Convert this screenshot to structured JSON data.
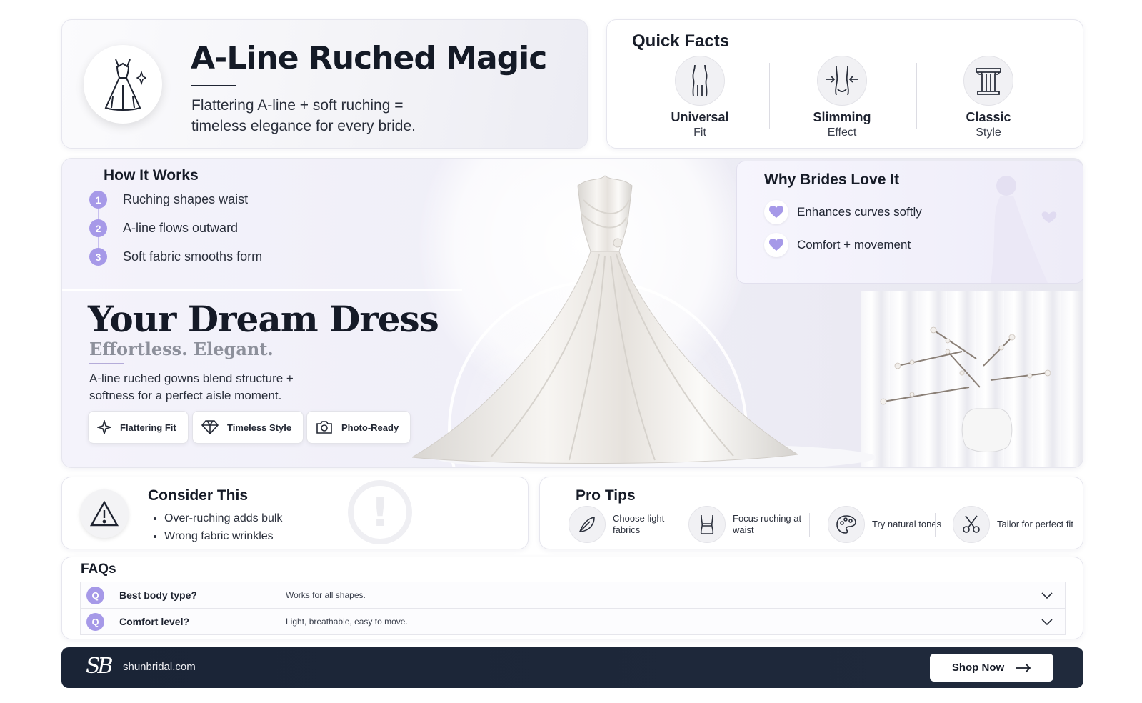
{
  "hero": {
    "title": "A-Line Ruched Magic",
    "subtitle": "Flattering A-line + soft ruching = timeless elegance for every bride.",
    "icon": "dress-sparkle-icon"
  },
  "quick_facts": {
    "heading": "Quick Facts",
    "items": [
      {
        "title": "Universal",
        "subtitle": "Fit",
        "icon": "body-silhouette-icon"
      },
      {
        "title": "Slimming",
        "subtitle": "Effect",
        "icon": "waist-arrows-icon"
      },
      {
        "title": "Classic",
        "subtitle": "Style",
        "icon": "column-icon"
      }
    ]
  },
  "how_it_works": {
    "heading": "How It Works",
    "steps": [
      {
        "num": "1",
        "label": "Ruching shapes waist"
      },
      {
        "num": "2",
        "label": "A-line flows outward"
      },
      {
        "num": "3",
        "label": "Soft fabric smooths form"
      }
    ]
  },
  "why_brides": {
    "heading": "Why Brides Love It",
    "items": [
      {
        "label": "Enhances curves softly",
        "icon": "heart-icon"
      },
      {
        "label": "Comfort + movement",
        "icon": "heart-icon"
      }
    ]
  },
  "dream": {
    "title": "Your Dream Dress",
    "subtitle": "Effortless. Elegant.",
    "description": "A-line ruched gowns blend structure + softness for a perfect aisle moment.",
    "pills": [
      {
        "label": "Flattering Fit",
        "icon": "sparkle-icon"
      },
      {
        "label": "Timeless Style",
        "icon": "diamond-icon"
      },
      {
        "label": "Photo-Ready",
        "icon": "camera-icon"
      }
    ]
  },
  "consider": {
    "heading": "Consider This",
    "items": [
      "Over-ruching adds bulk",
      "Wrong fabric wrinkles"
    ],
    "icon": "warning-icon"
  },
  "pro_tips": {
    "heading": "Pro Tips",
    "items": [
      {
        "label": "Choose light fabrics",
        "icon": "feather-icon"
      },
      {
        "label": "Focus ruching at waist",
        "icon": "bodice-icon"
      },
      {
        "label": "Try natural tones",
        "icon": "palette-icon"
      },
      {
        "label": "Tailor for perfect fit",
        "icon": "scissors-icon"
      }
    ]
  },
  "faqs": {
    "heading": "FAQs",
    "items": [
      {
        "badge": "Q",
        "question": "Best body type?",
        "answer": "Works for all shapes."
      },
      {
        "badge": "Q",
        "question": "Comfort level?",
        "answer": "Light, breathable, easy to move."
      }
    ]
  },
  "footer": {
    "logo": "SB",
    "site": "shunbridal.com",
    "cta": "Shop Now"
  },
  "colors": {
    "accent": "#a699e8",
    "footer_bg": "#1a2436",
    "text_dark": "#161b27"
  }
}
